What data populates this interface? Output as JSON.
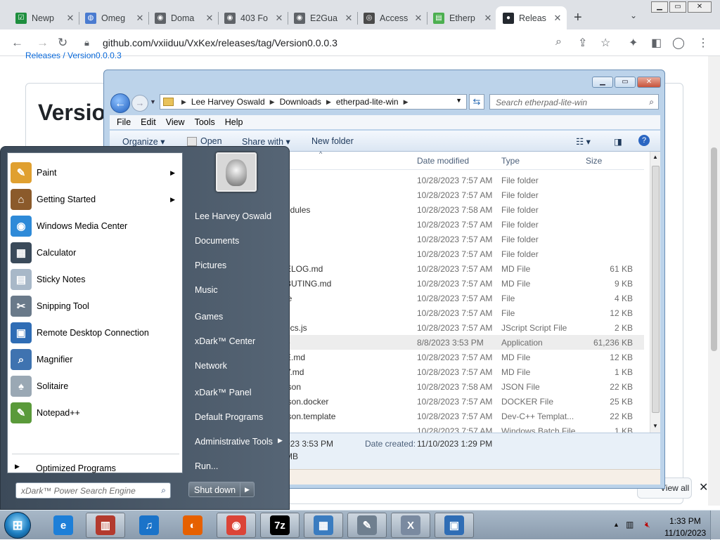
{
  "browser": {
    "tabs": [
      {
        "title": "Newp",
        "color": "#1e8e3e",
        "glyph": "☑"
      },
      {
        "title": "Omeg",
        "color": "#4a7bd0",
        "glyph": "◍"
      },
      {
        "title": "Doma",
        "color": "#5f6368",
        "glyph": "◉"
      },
      {
        "title": "403 Fo",
        "color": "#5f6368",
        "glyph": "◉"
      },
      {
        "title": "E2Gua",
        "color": "#5f6368",
        "glyph": "◉"
      },
      {
        "title": "Access",
        "color": "#4a4a4a",
        "glyph": "◎"
      },
      {
        "title": "Etherp",
        "color": "#4caf50",
        "glyph": "▤"
      },
      {
        "title": "Releas",
        "color": "#24292f",
        "glyph": "●"
      }
    ],
    "close_glyph": "✕",
    "new_tab": "+",
    "tab_search": "⌄",
    "url": "github.com/vxiiduu/VxKex/releases/tag/Version0.0.0.3",
    "window_controls": {
      "minimize": "▁",
      "restore": "▭",
      "close": "✕"
    }
  },
  "github": {
    "breadcrumb": "Releases / Version0.0.0.3",
    "title": "Version",
    "view_all": "View all"
  },
  "explorer": {
    "title_buttons": {
      "minimize": "▁",
      "maximize": "▭",
      "close": "✕"
    },
    "address": [
      "Lee Harvey Oswald",
      "Downloads",
      "etherpad-lite-win"
    ],
    "search_placeholder": "Search etherpad-lite-win",
    "menu": [
      "File",
      "Edit",
      "View",
      "Tools",
      "Help"
    ],
    "commands": {
      "organize": "Organize",
      "open": "Open",
      "share_with": "Share with",
      "new_folder": "New folder"
    },
    "columns": {
      "date": "Date modified",
      "type": "Type",
      "size": "Size"
    },
    "files": [
      {
        "name": "",
        "date": "10/28/2023 7:57 AM",
        "type": "File folder",
        "size": ""
      },
      {
        "name": "",
        "date": "10/28/2023 7:57 AM",
        "type": "File folder",
        "size": ""
      },
      {
        "name": "odules",
        "date": "10/28/2023 7:58 AM",
        "type": "File folder",
        "size": ""
      },
      {
        "name": "",
        "date": "10/28/2023 7:57 AM",
        "type": "File folder",
        "size": ""
      },
      {
        "name": "",
        "date": "10/28/2023 7:57 AM",
        "type": "File folder",
        "size": ""
      },
      {
        "name": "",
        "date": "10/28/2023 7:57 AM",
        "type": "File folder",
        "size": ""
      },
      {
        "name": "ELOG.md",
        "date": "10/28/2023 7:57 AM",
        "type": "MD File",
        "size": "61 KB"
      },
      {
        "name": "BUTING.md",
        "date": "10/28/2023 7:57 AM",
        "type": "MD File",
        "size": "9 KB"
      },
      {
        "name": "le",
        "date": "10/28/2023 7:57 AM",
        "type": "File",
        "size": "4 KB"
      },
      {
        "name": "",
        "date": "10/28/2023 7:57 AM",
        "type": "File",
        "size": "12 KB"
      },
      {
        "name": "ocs.js",
        "date": "10/28/2023 7:57 AM",
        "type": "JScript Script File",
        "size": "2 KB"
      },
      {
        "name": "e",
        "date": "8/8/2023 3:53 PM",
        "type": "Application",
        "size": "61,236 KB"
      },
      {
        "name": "E.md",
        "date": "10/28/2023 7:57 AM",
        "type": "MD File",
        "size": "12 KB"
      },
      {
        "name": "Y.md",
        "date": "10/28/2023 7:57 AM",
        "type": "MD File",
        "size": "1 KB"
      },
      {
        "name": "json",
        "date": "10/28/2023 7:58 AM",
        "type": "JSON File",
        "size": "22 KB"
      },
      {
        "name": "json.docker",
        "date": "10/28/2023 7:57 AM",
        "type": "DOCKER File",
        "size": "25 KB"
      },
      {
        "name": "json.template",
        "date": "10/28/2023 7:57 AM",
        "type": "Dev-C++ Templat...",
        "size": "22 KB"
      },
      {
        "name": "",
        "date": "10/28/2023 7:57 AM",
        "type": "Windows Batch File",
        "size": "1 KB"
      }
    ],
    "details": {
      "modified": "023 3:53 PM",
      "created_label": "Date created:",
      "created": "11/10/2023 1:29 PM",
      "size": "MB"
    }
  },
  "startmenu": {
    "programs": [
      {
        "name": "Paint",
        "has_arrow": true,
        "color": "#e0a030",
        "glyph": "✎"
      },
      {
        "name": "Getting Started",
        "has_arrow": true,
        "color": "#8b5a2b",
        "glyph": "⌂"
      },
      {
        "name": "Windows Media Center",
        "has_arrow": false,
        "color": "#2e8ad8",
        "glyph": "◉"
      },
      {
        "name": "Calculator",
        "has_arrow": false,
        "color": "#3a4a5a",
        "glyph": "▦"
      },
      {
        "name": "Sticky Notes",
        "has_arrow": false,
        "color": "#a8b8c8",
        "glyph": "▤"
      },
      {
        "name": "Snipping Tool",
        "has_arrow": false,
        "color": "#6a7a8a",
        "glyph": "✂"
      },
      {
        "name": "Remote Desktop Connection",
        "has_arrow": false,
        "color": "#2f6db5",
        "glyph": "▣"
      },
      {
        "name": "Magnifier",
        "has_arrow": false,
        "color": "#3f73b0",
        "glyph": "⌕"
      },
      {
        "name": "Solitaire",
        "has_arrow": false,
        "color": "#9aa8b4",
        "glyph": "♠"
      },
      {
        "name": "Notepad++",
        "has_arrow": false,
        "color": "#5a9a3a",
        "glyph": "✎"
      }
    ],
    "optimized": "Optimized Programs",
    "search_placeholder": "xDark™ Power Search Engine",
    "right": [
      {
        "label": "Lee Harvey Oswald",
        "arrow": false
      },
      {
        "label": "Documents",
        "arrow": false
      },
      {
        "label": "Pictures",
        "arrow": false
      },
      {
        "label": "Music",
        "arrow": false
      },
      {
        "label": "Games",
        "arrow": false
      },
      {
        "label": "xDark™ Center",
        "arrow": false
      },
      {
        "label": "Network",
        "arrow": false
      },
      {
        "label": "xDark™ Panel",
        "arrow": false
      },
      {
        "label": "Default Programs",
        "arrow": false
      },
      {
        "label": "Administrative Tools",
        "arrow": true
      },
      {
        "label": "Run...",
        "arrow": false
      }
    ],
    "shutdown": "Shut down"
  },
  "taskbar": {
    "apps": [
      {
        "name": "internet-explorer",
        "glyph": "e",
        "color": "#1d7fd8",
        "pinned": false
      },
      {
        "name": "wmp",
        "glyph": "▥",
        "color": "#b33a2e",
        "pinned": true
      },
      {
        "name": "music",
        "glyph": "♫",
        "color": "#1a73c9",
        "pinned": false
      },
      {
        "name": "firefox",
        "glyph": "◐",
        "color": "#e66000",
        "pinned": false
      },
      {
        "name": "chrome",
        "glyph": "◉",
        "color": "#db4437",
        "pinned": true
      },
      {
        "name": "7zip",
        "glyph": "7z",
        "color": "#000000",
        "pinned": true
      },
      {
        "name": "control-panel",
        "glyph": "▦",
        "color": "#3a7cc0",
        "pinned": true
      },
      {
        "name": "tools",
        "glyph": "✎",
        "color": "#6f7f8f",
        "pinned": true
      },
      {
        "name": "xenon",
        "glyph": "X",
        "color": "#7a8aa0",
        "pinned": true
      },
      {
        "name": "remote",
        "glyph": "▣",
        "color": "#2f6db5",
        "pinned": true
      }
    ],
    "time": "1:33 PM",
    "date": "11/10/2023"
  }
}
